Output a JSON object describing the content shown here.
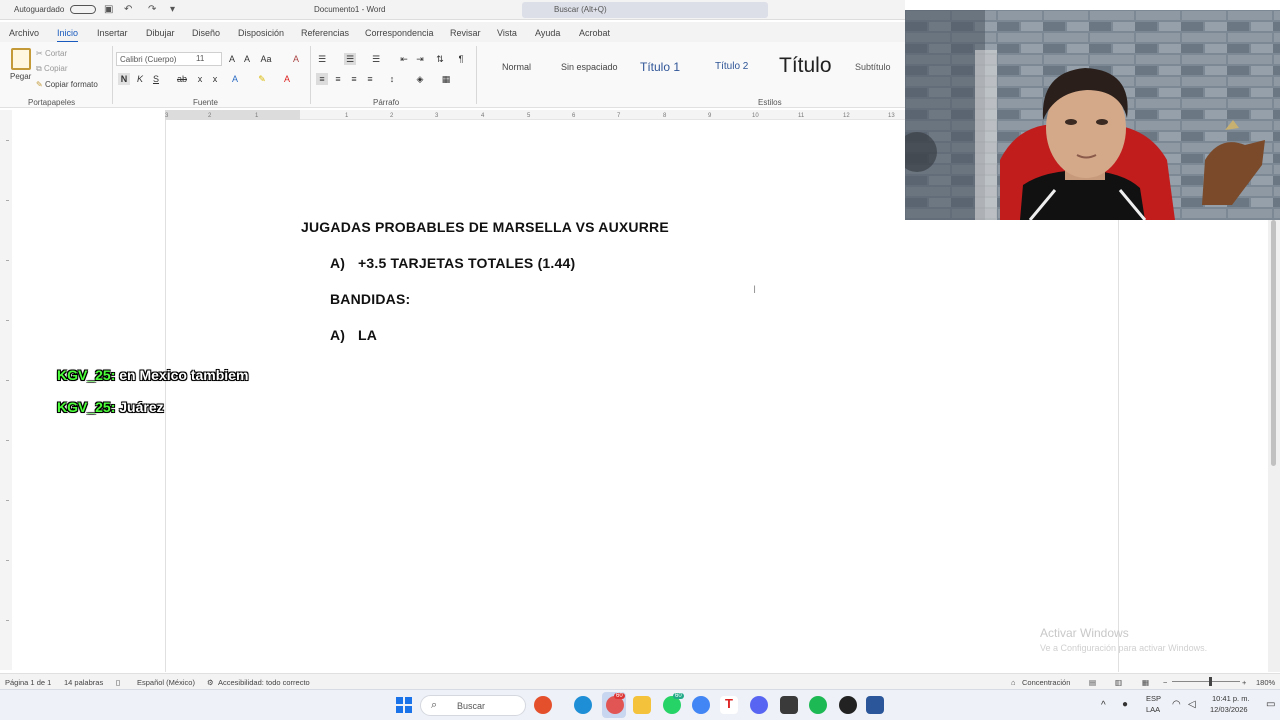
{
  "titlebar": {
    "autosave": "Autoguardado",
    "document_title": "Documento1 - Word",
    "search_placeholder": "Buscar (Alt+Q)"
  },
  "ribbon_tabs": [
    "Archivo",
    "Inicio",
    "Insertar",
    "Dibujar",
    "Diseño",
    "Disposición",
    "Referencias",
    "Correspondencia",
    "Revisar",
    "Vista",
    "Ayuda",
    "Acrobat"
  ],
  "ribbon": {
    "clipboard": {
      "paste": "Pegar",
      "cut": "Cortar",
      "copy": "Copiar",
      "format_painter": "Copiar formato",
      "group_label": "Portapapeles"
    },
    "font": {
      "font_name": "Calibri (Cuerpo)",
      "font_size": "11",
      "bold": "N",
      "italic": "K",
      "underline": "S",
      "group_label": "Fuente"
    },
    "paragraph": {
      "group_label": "Párrafo"
    },
    "styles": {
      "items": [
        "Normal",
        "Sin espaciado",
        "Título 1",
        "Título 2",
        "Título",
        "Subtítulo"
      ],
      "group_label": "Estilos"
    }
  },
  "ruler_ticks": [
    "3",
    "2",
    "1",
    "1",
    "2",
    "3",
    "4",
    "5",
    "6",
    "7",
    "8",
    "9",
    "10",
    "11",
    "12",
    "13"
  ],
  "document": {
    "heading": "JUGADAS PROBABLES DE MARSELLA VS AUXURRE",
    "item_a_marker": "A)",
    "item_a_text": "+3.5 TARJETAS TOTALES (1.44)",
    "bandidas": "BANDIDAS:",
    "item_b_marker": "A)",
    "item_b_text": "LA"
  },
  "chat": [
    {
      "user": "KGV_25:",
      "message": "en Mexico tambiem"
    },
    {
      "user": "KGV_25:",
      "message": "Juárez"
    }
  ],
  "watermark": {
    "title": "Activar Windows",
    "subtitle": "Ve a Configuración para activar Windows."
  },
  "statusbar": {
    "page": "Página 1 de 1",
    "words": "14 palabras",
    "language": "Español (México)",
    "accessibility": "Accesibilidad: todo correcto",
    "focus": "Concentración",
    "zoom": "180%"
  },
  "taskbar": {
    "search": "Buscar",
    "lang_top": "ESP",
    "lang_bottom": "LAA",
    "time": "10:41 p. m.",
    "date": "12/03/2026",
    "badge_a": "60",
    "badge_b": "60"
  },
  "colors": {
    "accent": "#185abd",
    "chat_user": "#4cff3a",
    "word_blue": "#2b579a"
  }
}
